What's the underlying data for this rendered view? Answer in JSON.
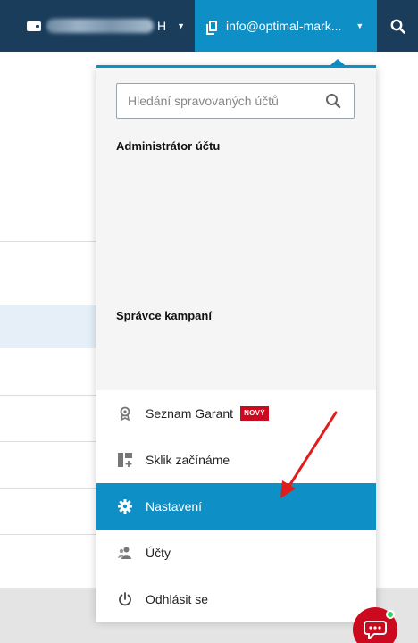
{
  "header": {
    "account_name_suffix": "H",
    "account_email": "info@optimal-mark...",
    "icons": [
      "wallet-icon",
      "documents-icon",
      "search-icon",
      "caret-down-icon"
    ]
  },
  "dropdown": {
    "search_placeholder": "Hledání spravovaných účtů",
    "section_admin": "Administrátor účtu",
    "section_campaigns": "Správce kampaní",
    "menu_items": [
      {
        "label": "Seznam Garant",
        "icon": "award-icon",
        "badge": "NOVÝ"
      },
      {
        "label": "Sklik začínáme",
        "icon": "dashboard-add-icon"
      },
      {
        "label": "Nastavení",
        "icon": "gear-icon",
        "active": true
      },
      {
        "label": "Účty",
        "icon": "users-icon"
      },
      {
        "label": "Odhlásit se",
        "icon": "power-icon"
      }
    ]
  },
  "colors": {
    "topbar": "#1b3d5c",
    "accent": "#0e90c6",
    "badge": "#cc0a1f",
    "online": "#2fd35d"
  }
}
